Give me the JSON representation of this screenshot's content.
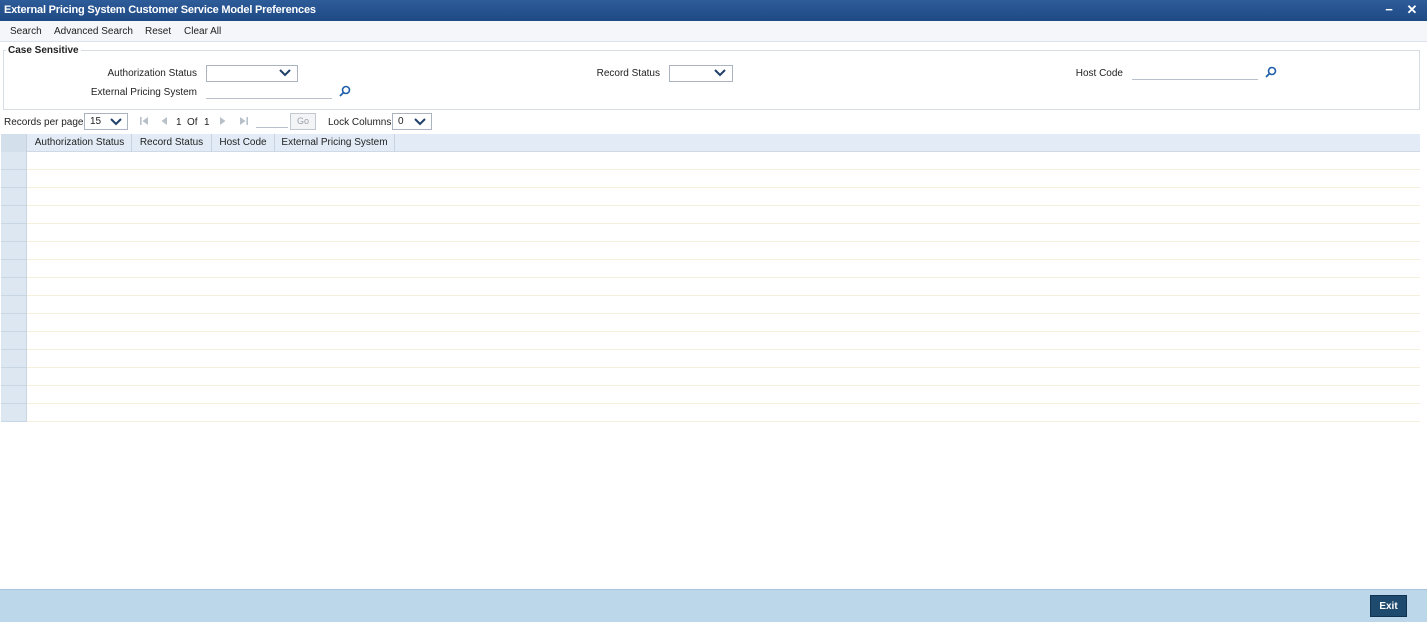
{
  "window": {
    "title": "External Pricing System Customer Service Model Preferences",
    "minimize_label": "−",
    "close_label": "✕"
  },
  "toolbar": {
    "search": "Search",
    "advanced_search": "Advanced Search",
    "reset": "Reset",
    "clear_all": "Clear All"
  },
  "criteria": {
    "legend": "Case Sensitive",
    "authorization_status_label": "Authorization Status",
    "authorization_status_value": "",
    "record_status_label": "Record Status",
    "record_status_value": "",
    "host_code_label": "Host Code",
    "host_code_value": "",
    "external_pricing_system_label": "External Pricing System",
    "external_pricing_system_value": ""
  },
  "pager": {
    "records_per_page_label": "Records per page",
    "records_per_page_value": "15",
    "current_page": "1",
    "of_label": "Of",
    "total_pages": "1",
    "go_label": "Go",
    "lock_columns_label": "Lock Columns",
    "lock_columns_value": "0"
  },
  "grid": {
    "columns": [
      "Authorization Status",
      "Record Status",
      "Host Code",
      "External Pricing System"
    ],
    "row_count": 15
  },
  "footer": {
    "exit_label": "Exit"
  },
  "colors": {
    "titlebar": "#1e4a85",
    "accent_icon": "#1f5fa8",
    "footer": "#bcd6ea",
    "exit_button": "#1e4a6e"
  }
}
